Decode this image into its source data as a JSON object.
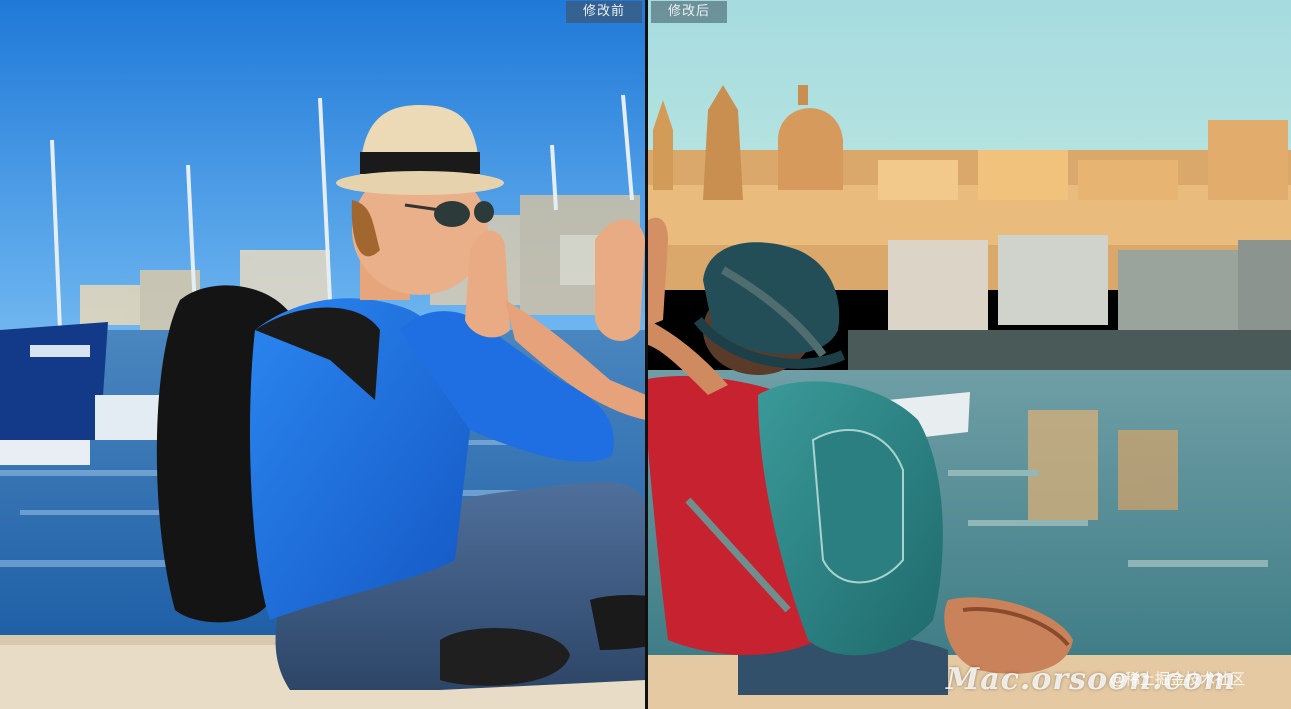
{
  "labels": {
    "before": "修改前",
    "after": "修改后"
  },
  "watermarks": {
    "site": "Mac.orsoon.com",
    "community": "@稀土掘金技术社区"
  },
  "colors": {
    "sky_before": "#2f8fe6",
    "sky_after": "#a9dcdc",
    "water_before": "#2e6fb0",
    "water_after": "#4f8f97",
    "shirt_man": "#1e6fe0",
    "shirt_boy": "#c8202c",
    "backpack_boy": "#2e8a8a",
    "label_bg": "#3c5a78"
  }
}
